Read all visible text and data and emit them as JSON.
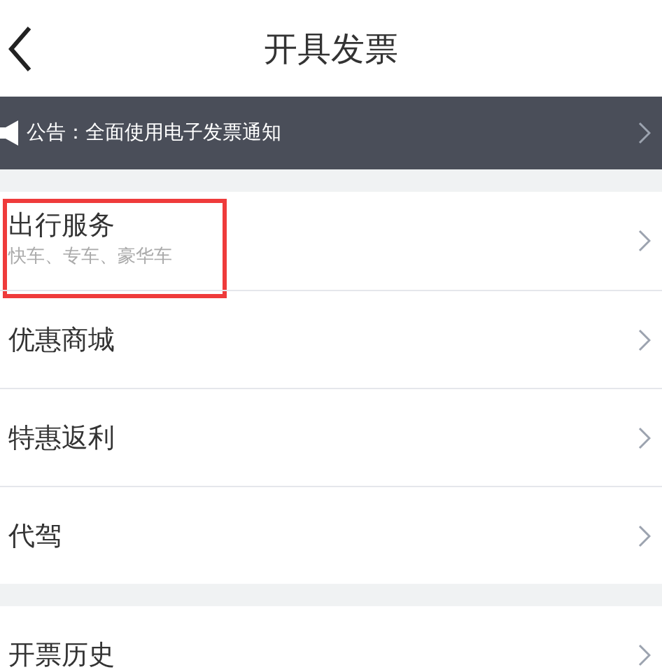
{
  "header": {
    "title": "开具发票"
  },
  "notice": {
    "text": "公告：全面使用电子发票通知"
  },
  "groups": [
    {
      "items": [
        {
          "label": "出行服务",
          "subtitle": "快车、专车、豪华车",
          "highlighted": true
        },
        {
          "label": "优惠商城",
          "highlighted": false
        },
        {
          "label": "特惠返利",
          "highlighted": false
        },
        {
          "label": "代驾",
          "highlighted": false
        }
      ]
    },
    {
      "items": [
        {
          "label": "开票历史",
          "highlighted": false
        }
      ]
    }
  ]
}
